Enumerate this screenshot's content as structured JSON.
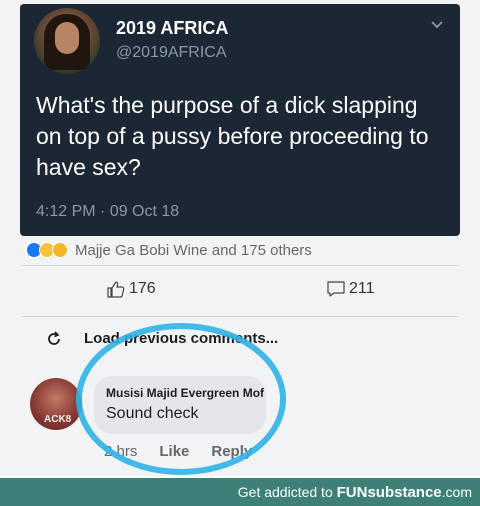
{
  "tweet": {
    "display_name": "2019 AFRICA",
    "handle": "@2019AFRICA",
    "text": "What's the purpose of a dick slapping on top of a pussy before proceeding to have sex?",
    "timestamp": "4:12 PM · 09 Oct 18"
  },
  "post": {
    "reactions_text": "Majje Ga Bobi Wine and 175 others",
    "like_count": "176",
    "comment_count": "211",
    "load_comments_label": "Load previous comments..."
  },
  "comment": {
    "author": "Musisi Majid Evergreen Mof",
    "text": "Sound check",
    "time": "2 hrs",
    "like_label": "Like",
    "reply_label": "Reply",
    "avatar_tag": "ACK8"
  },
  "footer": {
    "prefix": "Get addicted to ",
    "brand": "FUNsubstance",
    "suffix": ".com"
  },
  "colors": {
    "tweet_bg": "#1b2735",
    "highlight": "#2fb3e6",
    "footer_bg": "#3d8077"
  }
}
